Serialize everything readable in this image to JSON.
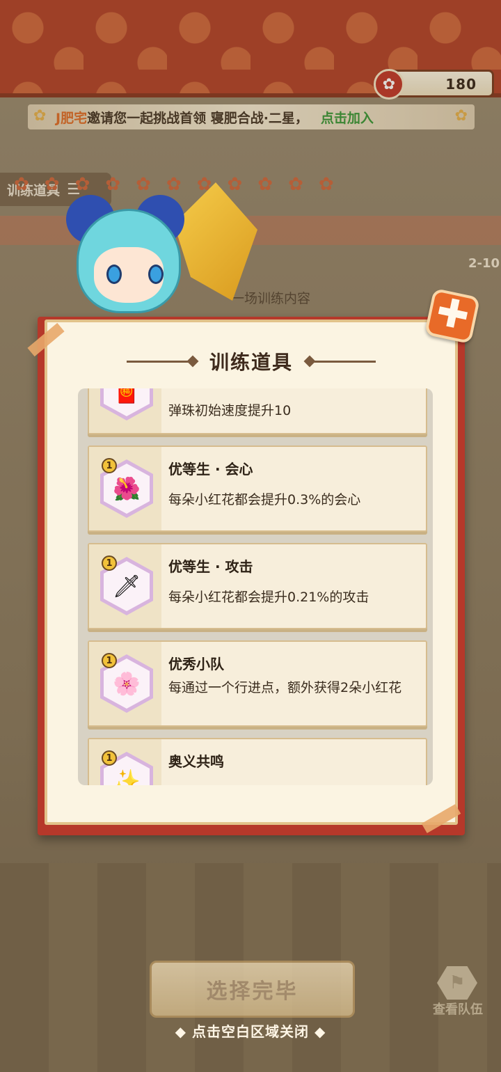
{
  "currency": {
    "amount": "180"
  },
  "invite": {
    "inviter": "J肥宅",
    "text": "邀请您一起挑战首领 寝肥合战·二星，",
    "action": "点击加入"
  },
  "background": {
    "training_tab": "训练道具",
    "level": "2-10",
    "behind_text": "一场训练内容"
  },
  "modal": {
    "title": "训练道具",
    "close_symbol": "✚",
    "items": [
      {
        "name": "",
        "desc": "弹珠初始速度提升10",
        "badge": "",
        "icon": "speed-item-icon"
      },
      {
        "name": "优等生 · 会心",
        "desc": "每朵小红花都会提升0.3%的会心",
        "badge": "1",
        "icon": "flower-crit-icon"
      },
      {
        "name": "优等生 · 攻击",
        "desc": "每朵小红花都会提升0.21%的攻击",
        "badge": "1",
        "icon": "flower-sword-icon"
      },
      {
        "name": "优秀小队",
        "desc": "每通过一个行进点，额外获得2朵小红花",
        "badge": "1",
        "icon": "red-flower-icon"
      },
      {
        "name": "奥义共鸣",
        "desc": "",
        "badge": "1",
        "icon": "resonance-icon"
      }
    ]
  },
  "bottom": {
    "select_done": "选择完毕",
    "view_team": "查看队伍",
    "hint": "◆ 点击空白区域关闭 ◆"
  },
  "colors": {
    "modal_frame": "#b6382a",
    "accent_orange": "#e86a28",
    "join_green": "#3c9a3a"
  }
}
